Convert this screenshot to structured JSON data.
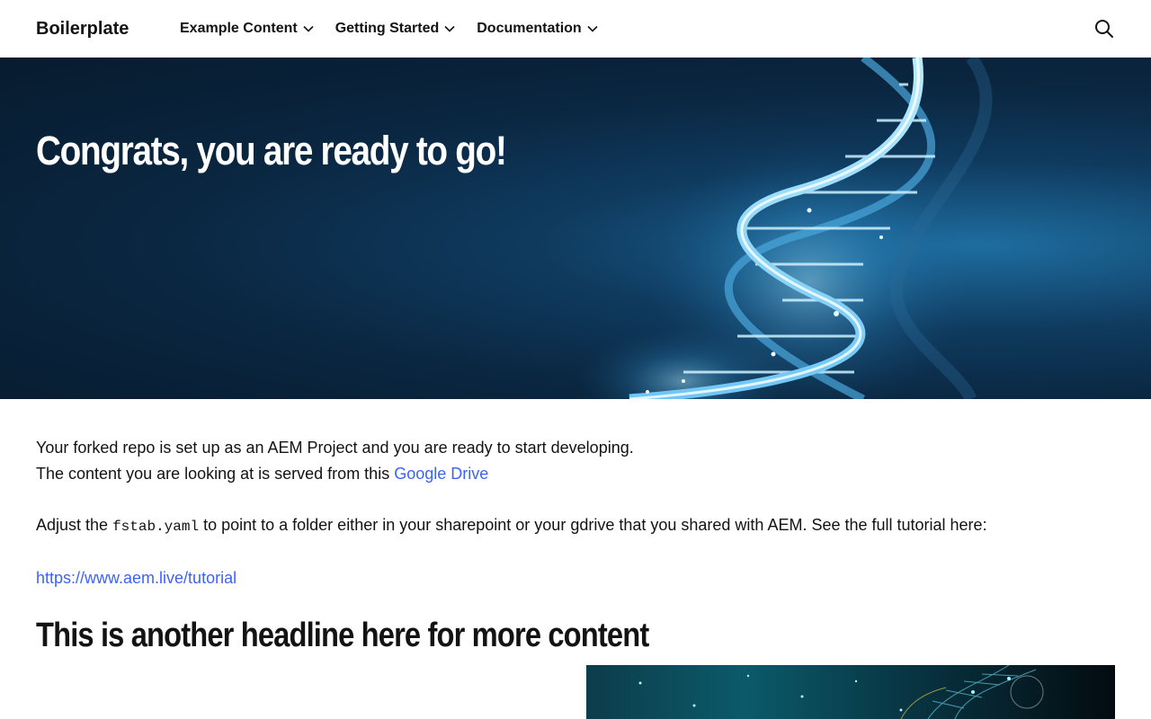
{
  "header": {
    "brand": "Boilerplate",
    "nav": [
      {
        "label": "Example Content"
      },
      {
        "label": "Getting Started"
      },
      {
        "label": "Documentation"
      }
    ],
    "search_icon": "search-icon"
  },
  "hero": {
    "title": "Congrats, you are ready to go!",
    "image": "dna-helix-blue"
  },
  "main": {
    "para1_line1": "Your forked repo is set up as an AEM Project and you are ready to start developing.",
    "para1_line2_prefix": "The content you are looking at is served from this ",
    "para1_link": "Google Drive",
    "para2_prefix": "Adjust the ",
    "para2_code": "fstab.yaml",
    "para2_suffix": " to point to a folder either in your sharepoint or your gdrive that you shared with AEM. See the full tutorial here:",
    "tutorial_link": "https://www.aem.live/tutorial",
    "headline2": "This is another headline here for more content",
    "column_image": "dna-network-teal"
  },
  "colors": {
    "link": "#3b63fb",
    "text": "#131313",
    "hero_bg": "#0a2640"
  }
}
